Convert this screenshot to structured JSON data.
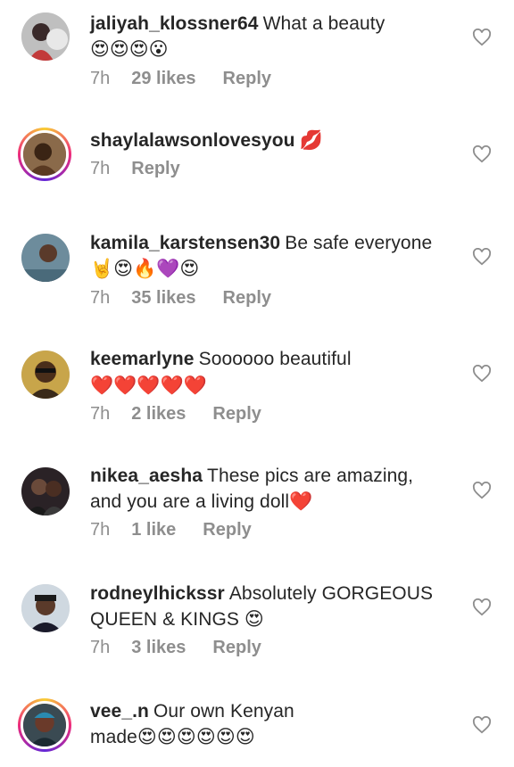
{
  "comments": [
    {
      "username": "jaliyah_klossner64",
      "text": "What a beauty",
      "emojis": "😍😍😍😮",
      "time": "7h",
      "likes": "29 likes",
      "reply": "Reply"
    },
    {
      "username": "shaylalawsonlovesyou",
      "text": "💋",
      "emojis": "",
      "time": "7h",
      "likes": "",
      "reply": "Reply"
    },
    {
      "username": "kamila_karstensen30",
      "text": "Be safe everyone",
      "emojis": "🤘😍🔥💜😍",
      "time": "7h",
      "likes": "35 likes",
      "reply": "Reply"
    },
    {
      "username": "keemarlyne",
      "text": "Soooooo beautiful",
      "emojis": "❤️❤️❤️❤️❤️",
      "time": "7h",
      "likes": "2 likes",
      "reply": "Reply"
    },
    {
      "username": "nikea_aesha",
      "text": "These pics are amazing,",
      "text2": "and you are a living doll❤️",
      "time": "7h",
      "likes": "1 like",
      "reply": "Reply"
    },
    {
      "username": "rodneylhickssr",
      "text": "Absolutely GORGEOUS",
      "text2": "QUEEN & KINGS 😍",
      "time": "7h",
      "likes": "3 likes",
      "reply": "Reply"
    },
    {
      "username": "vee_.n",
      "text": "Our own Kenyan",
      "text2": "made😍😍😍😍😍😍",
      "time": "",
      "likes": "",
      "reply": ""
    }
  ],
  "icons": {
    "like": "heart-outline-icon"
  },
  "colors": {
    "text": "#262626",
    "meta": "#8e8e8e",
    "story_ring_start": "#f9ce34",
    "story_ring_end": "#6228d7"
  }
}
